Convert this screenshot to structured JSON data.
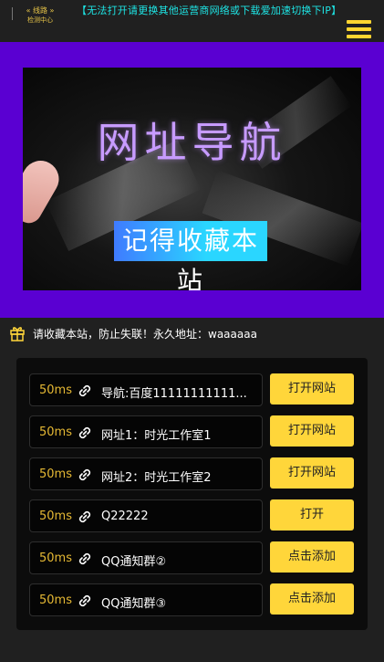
{
  "header": {
    "logo_line1": "« 线路 »",
    "logo_line2": "检测中心",
    "notice": "【无法打开请更换其他运营商网络或下载爱加速切换下IP】",
    "menu_icon": "hamburger-menu-icon"
  },
  "banner": {
    "title": "网址导航",
    "subtitle": "记得收藏本站",
    "bg_color": "#5a00d2"
  },
  "announcement": {
    "icon": "gift-icon",
    "text": "请收藏本站，防止失联！永久地址：waaaaaa"
  },
  "links": [
    {
      "ms": "50ms",
      "name": "导航:百度11111111111...",
      "button": "打开网站"
    },
    {
      "ms": "50ms",
      "name": "网址1：时光工作室1",
      "button": "打开网站"
    },
    {
      "ms": "50ms",
      "name": "网址2：时光工作室2",
      "button": "打开网站"
    },
    {
      "ms": "50ms",
      "name": "Q22222",
      "button": "打开"
    },
    {
      "ms": "50ms",
      "name": "QQ通知群②",
      "button": "点击添加"
    },
    {
      "ms": "50ms",
      "name": "QQ通知群③",
      "button": "点击添加"
    }
  ],
  "colors": {
    "accent": "#ffd63a",
    "latency": "#e6b934",
    "notice": "#1ee3e3",
    "page_bg": "#202020"
  }
}
